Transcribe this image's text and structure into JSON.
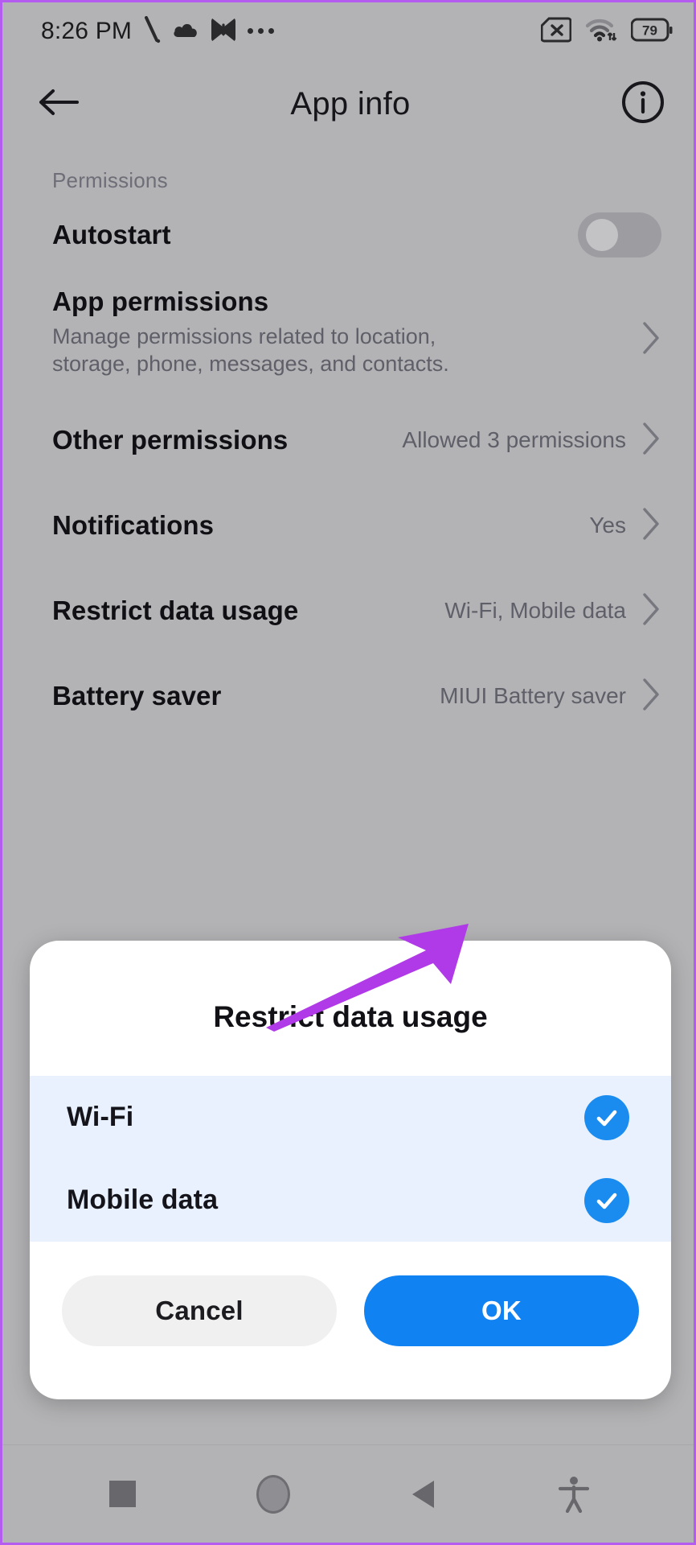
{
  "status_bar": {
    "time": "8:26 PM",
    "left_icons": [
      "mute-slash-icon",
      "cloud-icon",
      "download-sync-icon",
      "overflow-dots-icon"
    ],
    "right_icons": [
      "sim-card-x-icon",
      "wifi-data-icon",
      "battery-icon"
    ],
    "battery_level": "79"
  },
  "app_bar": {
    "back_icon": "back-arrow-icon",
    "title": "App info",
    "info_icon": "info-circle-icon"
  },
  "settings": {
    "section_label": "Permissions",
    "rows": [
      {
        "title": "Autostart",
        "subtitle": "",
        "value": "",
        "control": "toggle",
        "toggle_on": false,
        "chevron": false
      },
      {
        "title": "App permissions",
        "subtitle": "Manage permissions related to location, storage, phone, messages, and contacts.",
        "value": "",
        "control": "chevron",
        "chevron": true
      },
      {
        "title": "Other permissions",
        "subtitle": "",
        "value": "Allowed 3 permissions",
        "control": "chevron",
        "chevron": true
      },
      {
        "title": "Notifications",
        "subtitle": "",
        "value": "Yes",
        "control": "chevron",
        "chevron": true
      },
      {
        "title": "Restrict data usage",
        "subtitle": "",
        "value": "Wi-Fi, Mobile data",
        "control": "chevron",
        "chevron": true
      },
      {
        "title": "Battery saver",
        "subtitle": "",
        "value": "MIUI Battery saver",
        "control": "chevron",
        "chevron": true
      }
    ]
  },
  "dialog": {
    "title": "Restrict data usage",
    "options": [
      {
        "label": "Wi-Fi",
        "checked": true,
        "check_icon": "check-circle-icon"
      },
      {
        "label": "Mobile data",
        "checked": true,
        "check_icon": "check-circle-icon"
      }
    ],
    "cancel_label": "Cancel",
    "ok_label": "OK"
  },
  "annotation": {
    "type": "arrow",
    "color": "#b03ae8",
    "points_to": "Wi-Fi checkbox"
  },
  "nav_bar": {
    "buttons": [
      "recents-square-icon",
      "home-circle-icon",
      "back-triangle-icon",
      "accessibility-icon"
    ]
  },
  "colors": {
    "screen_background": "#b3b3b5",
    "dialog_background": "#ffffff",
    "option_row_background": "#e8f1fd",
    "accent_blue": "#1182f2",
    "check_blue": "#1a8cf0",
    "annotation_purple": "#b03ae8",
    "frame_border": "#b45cf0"
  }
}
